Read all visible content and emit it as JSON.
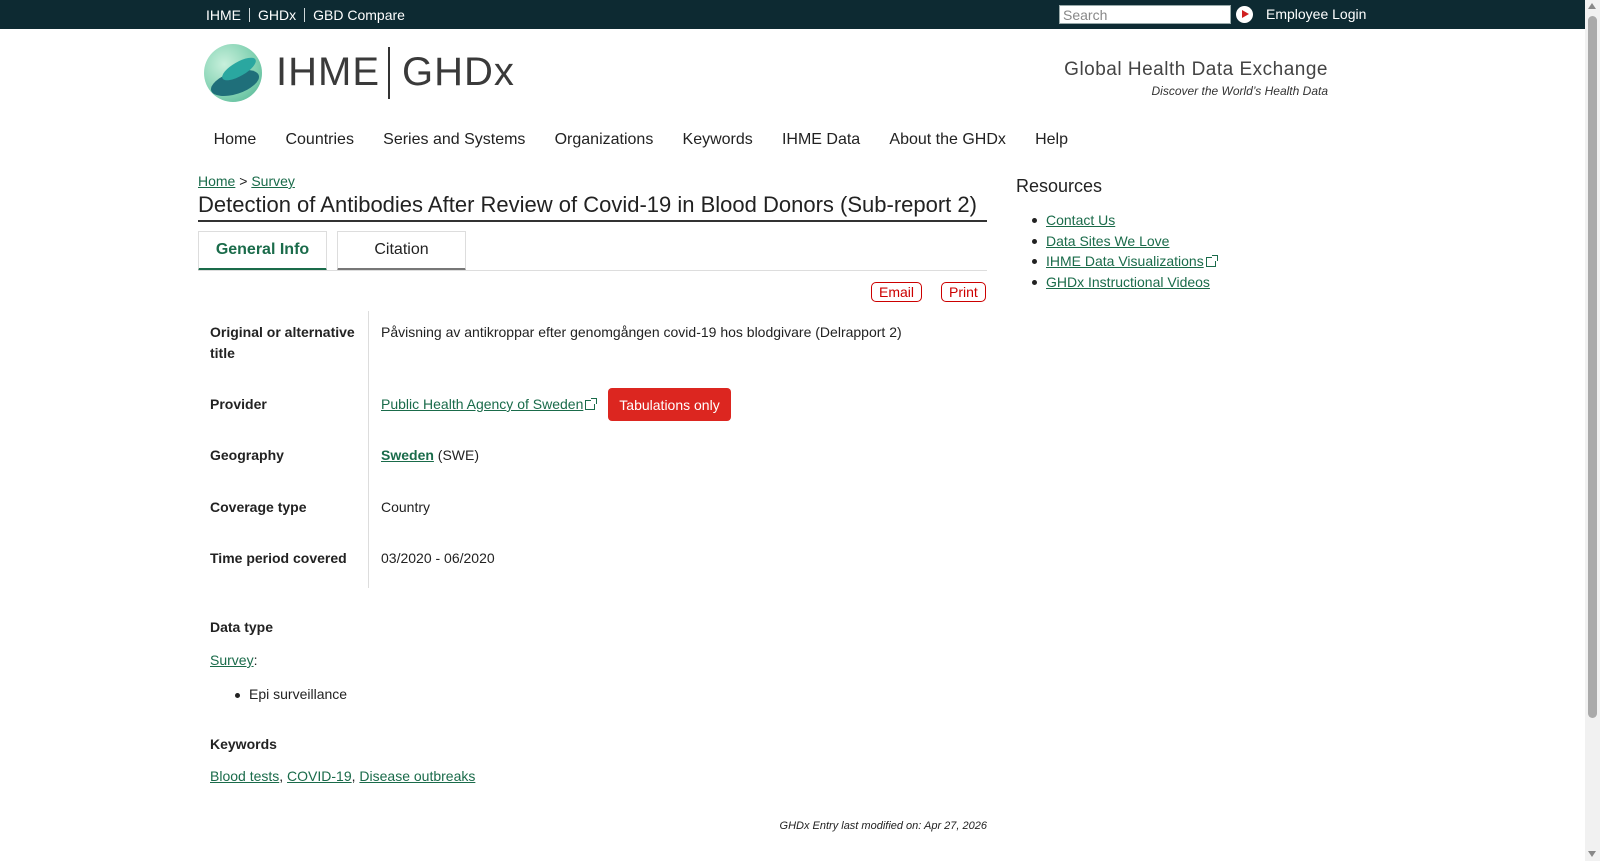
{
  "topbar": {
    "links": [
      "IHME",
      "GHDx",
      "GBD Compare"
    ],
    "search_placeholder": "Search",
    "employee_login": "Employee Login"
  },
  "header": {
    "logo_ihme": "IHME",
    "logo_ghdx": "GHDx",
    "site_title": "Global Health Data Exchange",
    "tagline": "Discover the World’s Health Data"
  },
  "nav": [
    "Home",
    "Countries",
    "Series and Systems",
    "Organizations",
    "Keywords",
    "IHME Data",
    "About the GHDx",
    "Help"
  ],
  "breadcrumb": {
    "home": "Home",
    "sep": ">",
    "current": "Survey"
  },
  "page_title": "Detection of Antibodies After Review of Covid-19 in Blood Donors (Sub-report 2)",
  "tabs": {
    "general": "General Info",
    "citation": "Citation"
  },
  "actions": {
    "email": "Email",
    "print": "Print"
  },
  "info": {
    "alt_title_label": "Original or alternative title",
    "alt_title_value": "Påvisning av antikroppar efter genomgången covid-19 hos blodgivare (Delrapport 2)",
    "provider_label": "Provider",
    "provider_value": "Public Health Agency of Sweden",
    "provider_badge": "Tabulations only",
    "geography_label": "Geography",
    "geography_value": "Sweden",
    "geography_code": "(SWE)",
    "coverage_label": "Coverage type",
    "coverage_value": "Country",
    "time_label": "Time period covered",
    "time_value": "03/2020 - 06/2020"
  },
  "data_type": {
    "label": "Data type",
    "link": "Survey",
    "suffix": ":",
    "items": [
      "Epi surveillance"
    ]
  },
  "keywords": {
    "label": "Keywords",
    "items": [
      "Blood tests",
      "COVID-19",
      "Disease outbreaks"
    ]
  },
  "modified": "GHDx Entry last modified on: Apr 27, 2026",
  "resources": {
    "title": "Resources",
    "items": [
      "Contact Us",
      "Data Sites We Love",
      "IHME Data Visualizations",
      "GHDx Instructional Videos"
    ]
  }
}
